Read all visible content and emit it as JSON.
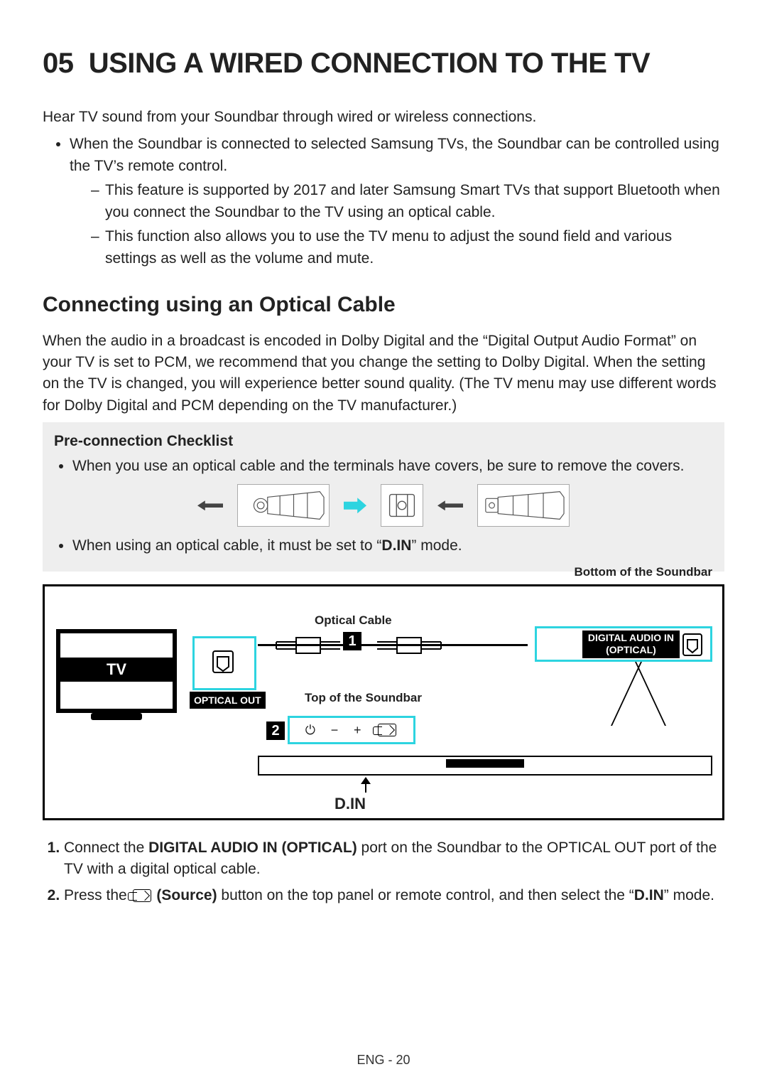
{
  "section_number": "05",
  "section_title": "USING A WIRED CONNECTION TO THE TV",
  "intro": "Hear TV sound from your Soundbar through wired or wireless connections.",
  "bullet1": "When the Soundbar is connected to selected Samsung TVs, the Soundbar can be controlled using the TV’s remote control.",
  "sub1": "This feature is supported by 2017 and later Samsung Smart TVs that support Bluetooth when you connect the Soundbar to the TV using an optical cable.",
  "sub2": "This function also allows you to use the TV menu to adjust the sound field and various settings as well as the volume and mute.",
  "h2": "Connecting using an Optical Cable",
  "para2": "When the audio in a broadcast is encoded in Dolby Digital and the “Digital Output Audio Format” on your TV is set to PCM, we recommend that you change the setting to Dolby Digital. When the setting on the TV is changed, you will experience better sound quality. (The TV menu may use different words for Dolby Digital and PCM depending on the TV manufacturer.)",
  "checklist": {
    "title": "Pre-connection Checklist",
    "item1": "When you use an optical cable and the terminals have covers, be sure to remove the covers.",
    "item2_pre": "When using an optical cable, it must be set to “",
    "item2_bold": "D.IN",
    "item2_post": "” mode."
  },
  "diagram": {
    "bottom_label": "Bottom of the Soundbar",
    "cable_label": "Optical Cable",
    "tv": "TV",
    "optical_out": "OPTICAL OUT",
    "digital_in_l1": "DIGITAL AUDIO IN",
    "digital_in_l2": "(OPTICAL)",
    "top_label": "Top of the Soundbar",
    "num1": "1",
    "num2": "2",
    "din": "D.IN"
  },
  "step1_pre": "Connect the ",
  "step1_bold": "DIGITAL AUDIO IN (OPTICAL)",
  "step1_post": " port on the Soundbar to the OPTICAL OUT port of the TV with a digital optical cable.",
  "step2_pre": "Press the ",
  "step2_bold": " (Source)",
  "step2_mid": " button on the top panel or remote control, and then select the “",
  "step2_din": "D.IN",
  "step2_post": "” mode.",
  "footer": "ENG - 20"
}
